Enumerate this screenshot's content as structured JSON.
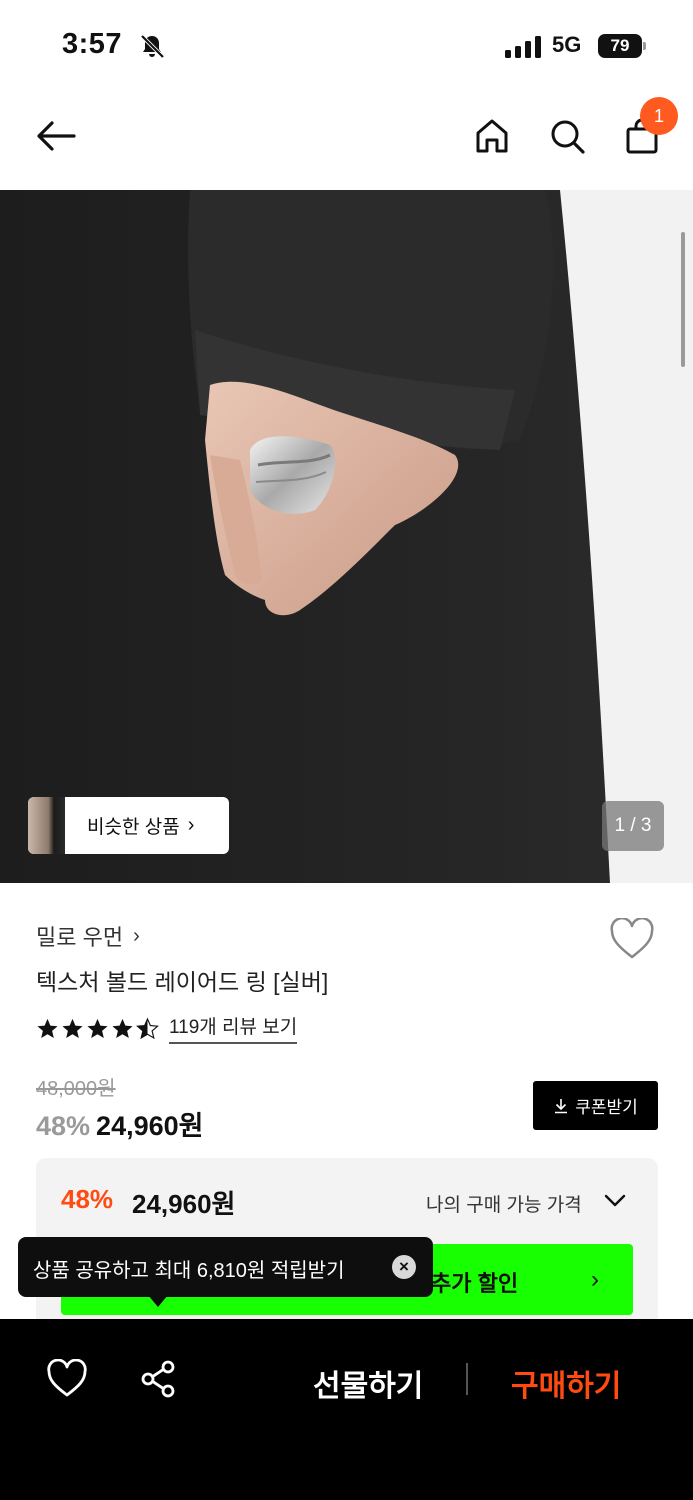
{
  "status_bar": {
    "time": "3:57",
    "network": "5G",
    "battery": "79"
  },
  "nav": {
    "back_icon": "arrow-left-icon",
    "home_icon": "home-icon",
    "search_icon": "search-icon",
    "bag_icon": "shopping-bag-icon",
    "cart_count": "1"
  },
  "hero": {
    "similar_label": "비슷한 상품",
    "page_counter": "1 / 3"
  },
  "product": {
    "brand": "밀로 우먼",
    "title": "텍스처 볼드 레이어드 링 [실버]",
    "rating": 4.5,
    "review_link": "119개 리뷰 보기",
    "original_price": "48,000원",
    "discount_rate": "48%",
    "sale_price": "24,960원",
    "coupon_label": "쿠폰받기"
  },
  "price_card": {
    "rate": "48%",
    "price": "24,960원",
    "label": "나의 구매 가능 가격",
    "promo_text": "추가 할인",
    "accent": "#17ff00"
  },
  "tooltip": {
    "text": "상품 공유하고 최대 6,810원 적립받기"
  },
  "bottom_bar": {
    "gift_label": "선물하기",
    "buy_label": "구매하기",
    "buy_color": "#ff4b12"
  }
}
